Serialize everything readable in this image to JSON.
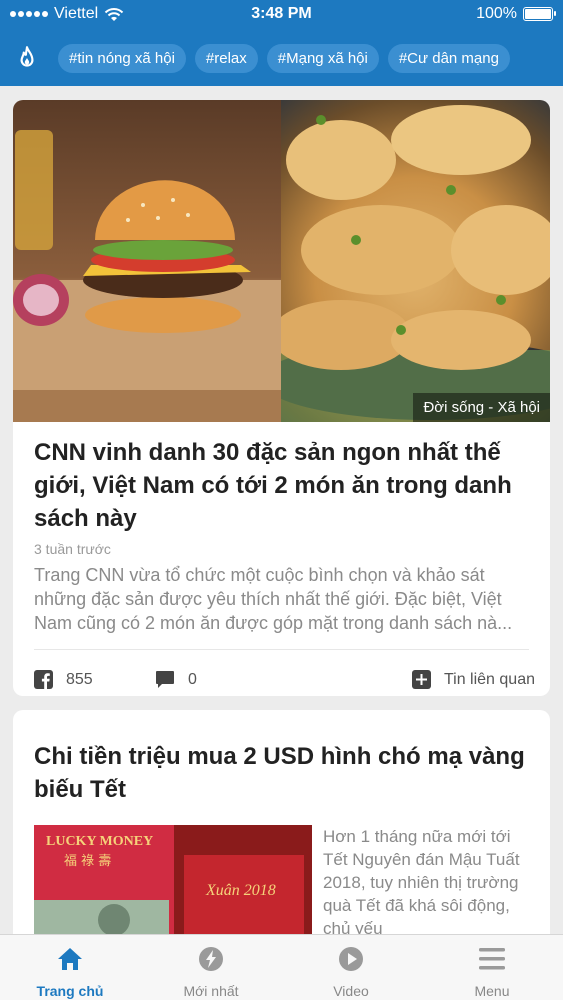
{
  "status_bar": {
    "carrier": "Viettel",
    "time": "3:48 PM",
    "battery": "100%"
  },
  "tags": [
    "#tin nóng xã hội",
    "#relax",
    "#Mạng xã hội",
    "#Cư dân mạng"
  ],
  "articles": [
    {
      "category": "Đời sống - Xã hội",
      "title": "CNN vinh danh 30 đặc sản ngon nhất thế giới, Việt Nam có tới 2 món ăn trong danh sách này",
      "time": "3 tuần trước",
      "summary": "Trang CNN vừa tổ chức một cuộc bình chọn và khảo sát những đặc sản được yêu thích nhất thế giới. Đặc biệt, Việt Nam cũng có 2 món ăn được góp mặt trong danh sách nà...",
      "facebook_count": "855",
      "comment_count": "0",
      "related_label": "Tin liên quan"
    },
    {
      "title": "Chi tiền triệu mua 2 USD hình chó mạ vàng biếu Tết",
      "summary": " Hơn 1 tháng nữa mới tới Tết Nguyên đán Mậu Tuất 2018, tuy nhiên thị trường quà Tết đã khá sôi động, chủ yếu",
      "image_text": {
        "lucky_money": "LUCKY MONEY",
        "chinese": "福 祿 壽",
        "xuan": "Xuân 2018"
      }
    }
  ],
  "tabbar": [
    "Trang chủ",
    "Mới nhất",
    "Video",
    "Menu"
  ],
  "colors": {
    "brand": "#1d79c0",
    "tag_bg": "#3b8fd1"
  }
}
